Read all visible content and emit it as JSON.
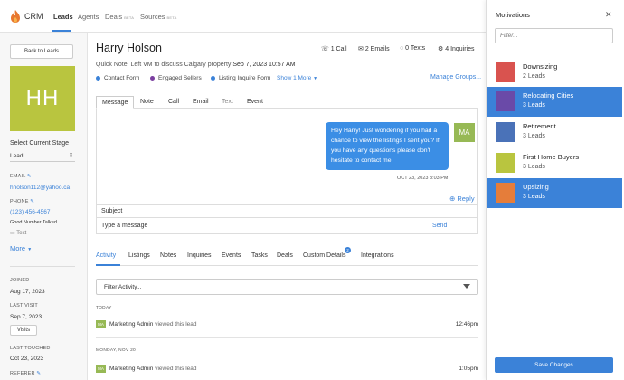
{
  "nav": {
    "brand": "CRM",
    "items": [
      {
        "label": "Leads",
        "beta": ""
      },
      {
        "label": "Agents",
        "beta": ""
      },
      {
        "label": "Deals",
        "beta": "BETA"
      },
      {
        "label": "Sources",
        "beta": "BETA"
      }
    ]
  },
  "left": {
    "back_label": "Back to Leads",
    "initials": "HH",
    "stage_title": "Select Current Stage",
    "stage_value": "Lead",
    "email_label": "EMAIL",
    "email": "hholson112@yahoo.ca",
    "phone_label": "PHONE",
    "phone": "(123) 456-4567",
    "phone_note": "Good Number Talked",
    "text_label": "Text",
    "more_label": "More",
    "joined_label": "JOINED",
    "joined": "Aug 17, 2023",
    "last_visit_label": "LAST VISIT",
    "last_visit": "Sep 7, 2023",
    "visits_button": "Visits",
    "last_touched_label": "LAST TOUCHED",
    "last_touched": "Oct 23, 2023",
    "referer_label": "REFERER"
  },
  "lead": {
    "name": "Harry Holson",
    "quick_note_prefix": "Quick Note: Left VM to discuss Calgary property",
    "quick_note_date": "Sep 7, 2023 10:57 AM",
    "stats": [
      "1 Call",
      "2 Emails",
      "0 Texts",
      "4 Inquiries"
    ],
    "tags": [
      {
        "label": "Contact Form",
        "color": "#3b82d8"
      },
      {
        "label": "Engaged Sellers",
        "color": "#7b3fa0"
      },
      {
        "label": "Listing Inquire Form",
        "color": "#3b82d8"
      }
    ],
    "show_more": "Show 1 More",
    "manage_groups": "Manage Groups..."
  },
  "compose": {
    "tabs": [
      "Message",
      "Note",
      "Call",
      "Email",
      "Text",
      "Event"
    ],
    "message": "Hey Harry! Just wondering if you had a chance to view the listings I sent you? If you have any questions please don't hesitate to contact me!",
    "sender_initials": "MA",
    "timestamp": "OCT 23, 2023 3:03 PM",
    "reply_label": "Reply",
    "subject_placeholder": "Subject",
    "message_placeholder": "Type a message",
    "send_label": "Send"
  },
  "activity": {
    "tabs": [
      "Activity",
      "Listings",
      "Notes",
      "Inquiries",
      "Events",
      "Tasks",
      "Deals",
      "Custom Details",
      "Integrations"
    ],
    "custom_details_badge": "2",
    "filter_label": "Filter Activity...",
    "groups": [
      {
        "day": "TODAY",
        "actor": "Marketing Admin",
        "action": "viewed this lead",
        "time": "12:46pm"
      },
      {
        "day": "MONDAY, NOV 20",
        "actor": "Marketing Admin",
        "action": "viewed this lead",
        "time": "1:05pm"
      }
    ],
    "actor_initials": "MA"
  },
  "motivations": {
    "title": "Motivations",
    "filter_placeholder": "Filter...",
    "items": [
      {
        "name": "Downsizing",
        "count": "2 Leads",
        "color": "#d9534f",
        "selected": false
      },
      {
        "name": "Relocating Cities",
        "count": "3 Leads",
        "color": "#6a4aa8",
        "selected": true
      },
      {
        "name": "Retirement",
        "count": "3 Leads",
        "color": "#4a72b8",
        "selected": false
      },
      {
        "name": "First Home Buyers",
        "count": "3 Leads",
        "color": "#b9c53f",
        "selected": false
      },
      {
        "name": "Upsizing",
        "count": "3 Leads",
        "color": "#e57d3a",
        "selected": true
      }
    ],
    "save_label": "Save Changes"
  }
}
